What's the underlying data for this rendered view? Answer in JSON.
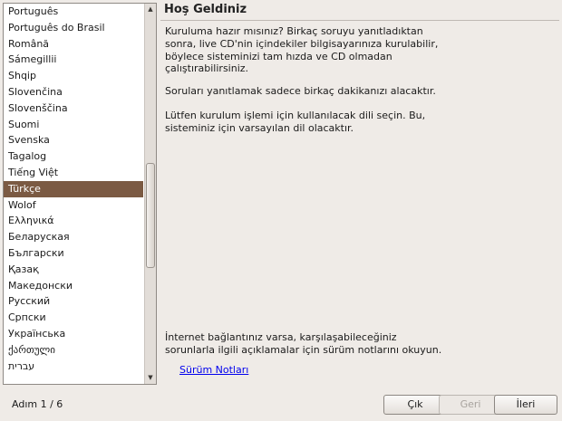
{
  "language_list": {
    "items": [
      "Português",
      "Português do Brasil",
      "Română",
      "Sámegillii",
      "Shqip",
      "Slovenčina",
      "Slovenščina",
      "Suomi",
      "Svenska",
      "Tagalog",
      "Tiếng Việt",
      "Türkçe",
      "Wolof",
      "Ελληνικά",
      "Беларуская",
      "Български",
      "Қазақ",
      "Македонски",
      "Русский",
      "Српски",
      "Українська",
      "ქართული",
      "עברית"
    ],
    "selected_index": 11,
    "scroll_up_glyph": "▲",
    "scroll_down_glyph": "▼"
  },
  "content": {
    "title": "Hoş Geldiniz",
    "paragraph_1": "Kuruluma hazır mısınız? Birkaç soruyu yanıtladıktan\nsonra, live CD'nin içindekiler bilgisayarınıza kurulabilir,\nböylece sisteminizi tam hızda ve CD olmadan\nçalıştırabilirsiniz.",
    "paragraph_2": "Soruları yanıtlamak sadece birkaç dakikanızı alacaktır.",
    "paragraph_3": "Lütfen kurulum işlemi için kullanılacak dili seçin. Bu,\nsisteminiz için varsayılan dil olacaktır.",
    "paragraph_4": "İnternet bağlantınız varsa, karşılaşabileceğiniz\nsorunlarla ilgili açıklamalar için sürüm notlarını okuyun.",
    "release_notes_link": "Sürüm Notları"
  },
  "footer": {
    "step": "Adım 1 / 6",
    "quit_label": "Çık",
    "back_label": "Geri",
    "next_label": "İleri"
  },
  "colors": {
    "selection": "#7b5a43",
    "link": "#0000ee",
    "window_background": "#efebe7"
  }
}
